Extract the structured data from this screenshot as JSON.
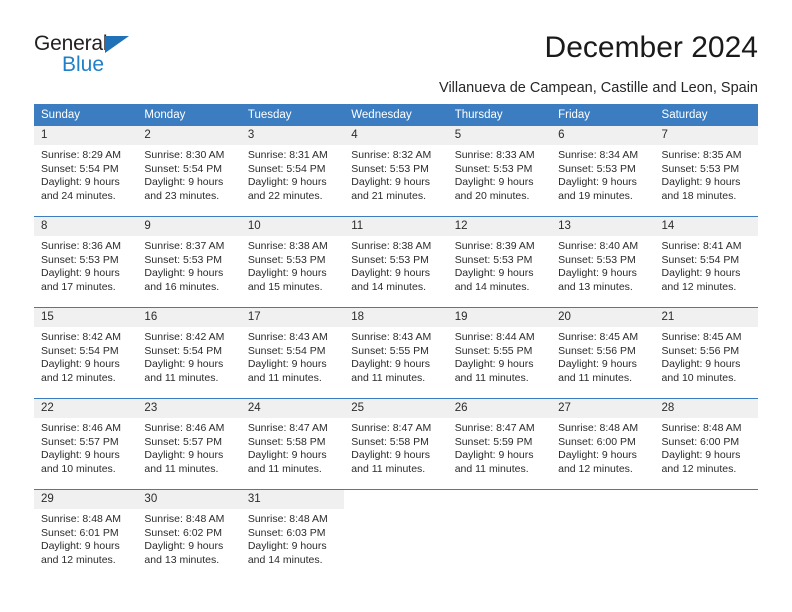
{
  "brand": {
    "name_dark": "General",
    "name_blue": "Blue",
    "accent_color": "#1f80c9",
    "triangle_color": "#1f71b8"
  },
  "header": {
    "title": "December 2024",
    "location": "Villanueva de Campean, Castille and Leon, Spain"
  },
  "calendar": {
    "header_bg": "#3b7dc0",
    "daynum_bg": "#f0f0f0",
    "weekday_headers": [
      "Sunday",
      "Monday",
      "Tuesday",
      "Wednesday",
      "Thursday",
      "Friday",
      "Saturday"
    ],
    "weeks": [
      [
        {
          "day": "1",
          "sunrise": "Sunrise: 8:29 AM",
          "sunset": "Sunset: 5:54 PM",
          "daylight1": "Daylight: 9 hours",
          "daylight2": "and 24 minutes."
        },
        {
          "day": "2",
          "sunrise": "Sunrise: 8:30 AM",
          "sunset": "Sunset: 5:54 PM",
          "daylight1": "Daylight: 9 hours",
          "daylight2": "and 23 minutes."
        },
        {
          "day": "3",
          "sunrise": "Sunrise: 8:31 AM",
          "sunset": "Sunset: 5:54 PM",
          "daylight1": "Daylight: 9 hours",
          "daylight2": "and 22 minutes."
        },
        {
          "day": "4",
          "sunrise": "Sunrise: 8:32 AM",
          "sunset": "Sunset: 5:53 PM",
          "daylight1": "Daylight: 9 hours",
          "daylight2": "and 21 minutes."
        },
        {
          "day": "5",
          "sunrise": "Sunrise: 8:33 AM",
          "sunset": "Sunset: 5:53 PM",
          "daylight1": "Daylight: 9 hours",
          "daylight2": "and 20 minutes."
        },
        {
          "day": "6",
          "sunrise": "Sunrise: 8:34 AM",
          "sunset": "Sunset: 5:53 PM",
          "daylight1": "Daylight: 9 hours",
          "daylight2": "and 19 minutes."
        },
        {
          "day": "7",
          "sunrise": "Sunrise: 8:35 AM",
          "sunset": "Sunset: 5:53 PM",
          "daylight1": "Daylight: 9 hours",
          "daylight2": "and 18 minutes."
        }
      ],
      [
        {
          "day": "8",
          "sunrise": "Sunrise: 8:36 AM",
          "sunset": "Sunset: 5:53 PM",
          "daylight1": "Daylight: 9 hours",
          "daylight2": "and 17 minutes."
        },
        {
          "day": "9",
          "sunrise": "Sunrise: 8:37 AM",
          "sunset": "Sunset: 5:53 PM",
          "daylight1": "Daylight: 9 hours",
          "daylight2": "and 16 minutes."
        },
        {
          "day": "10",
          "sunrise": "Sunrise: 8:38 AM",
          "sunset": "Sunset: 5:53 PM",
          "daylight1": "Daylight: 9 hours",
          "daylight2": "and 15 minutes."
        },
        {
          "day": "11",
          "sunrise": "Sunrise: 8:38 AM",
          "sunset": "Sunset: 5:53 PM",
          "daylight1": "Daylight: 9 hours",
          "daylight2": "and 14 minutes."
        },
        {
          "day": "12",
          "sunrise": "Sunrise: 8:39 AM",
          "sunset": "Sunset: 5:53 PM",
          "daylight1": "Daylight: 9 hours",
          "daylight2": "and 14 minutes."
        },
        {
          "day": "13",
          "sunrise": "Sunrise: 8:40 AM",
          "sunset": "Sunset: 5:53 PM",
          "daylight1": "Daylight: 9 hours",
          "daylight2": "and 13 minutes."
        },
        {
          "day": "14",
          "sunrise": "Sunrise: 8:41 AM",
          "sunset": "Sunset: 5:54 PM",
          "daylight1": "Daylight: 9 hours",
          "daylight2": "and 12 minutes."
        }
      ],
      [
        {
          "day": "15",
          "sunrise": "Sunrise: 8:42 AM",
          "sunset": "Sunset: 5:54 PM",
          "daylight1": "Daylight: 9 hours",
          "daylight2": "and 12 minutes."
        },
        {
          "day": "16",
          "sunrise": "Sunrise: 8:42 AM",
          "sunset": "Sunset: 5:54 PM",
          "daylight1": "Daylight: 9 hours",
          "daylight2": "and 11 minutes."
        },
        {
          "day": "17",
          "sunrise": "Sunrise: 8:43 AM",
          "sunset": "Sunset: 5:54 PM",
          "daylight1": "Daylight: 9 hours",
          "daylight2": "and 11 minutes."
        },
        {
          "day": "18",
          "sunrise": "Sunrise: 8:43 AM",
          "sunset": "Sunset: 5:55 PM",
          "daylight1": "Daylight: 9 hours",
          "daylight2": "and 11 minutes."
        },
        {
          "day": "19",
          "sunrise": "Sunrise: 8:44 AM",
          "sunset": "Sunset: 5:55 PM",
          "daylight1": "Daylight: 9 hours",
          "daylight2": "and 11 minutes."
        },
        {
          "day": "20",
          "sunrise": "Sunrise: 8:45 AM",
          "sunset": "Sunset: 5:56 PM",
          "daylight1": "Daylight: 9 hours",
          "daylight2": "and 11 minutes."
        },
        {
          "day": "21",
          "sunrise": "Sunrise: 8:45 AM",
          "sunset": "Sunset: 5:56 PM",
          "daylight1": "Daylight: 9 hours",
          "daylight2": "and 10 minutes."
        }
      ],
      [
        {
          "day": "22",
          "sunrise": "Sunrise: 8:46 AM",
          "sunset": "Sunset: 5:57 PM",
          "daylight1": "Daylight: 9 hours",
          "daylight2": "and 10 minutes."
        },
        {
          "day": "23",
          "sunrise": "Sunrise: 8:46 AM",
          "sunset": "Sunset: 5:57 PM",
          "daylight1": "Daylight: 9 hours",
          "daylight2": "and 11 minutes."
        },
        {
          "day": "24",
          "sunrise": "Sunrise: 8:47 AM",
          "sunset": "Sunset: 5:58 PM",
          "daylight1": "Daylight: 9 hours",
          "daylight2": "and 11 minutes."
        },
        {
          "day": "25",
          "sunrise": "Sunrise: 8:47 AM",
          "sunset": "Sunset: 5:58 PM",
          "daylight1": "Daylight: 9 hours",
          "daylight2": "and 11 minutes."
        },
        {
          "day": "26",
          "sunrise": "Sunrise: 8:47 AM",
          "sunset": "Sunset: 5:59 PM",
          "daylight1": "Daylight: 9 hours",
          "daylight2": "and 11 minutes."
        },
        {
          "day": "27",
          "sunrise": "Sunrise: 8:48 AM",
          "sunset": "Sunset: 6:00 PM",
          "daylight1": "Daylight: 9 hours",
          "daylight2": "and 12 minutes."
        },
        {
          "day": "28",
          "sunrise": "Sunrise: 8:48 AM",
          "sunset": "Sunset: 6:00 PM",
          "daylight1": "Daylight: 9 hours",
          "daylight2": "and 12 minutes."
        }
      ],
      [
        {
          "day": "29",
          "sunrise": "Sunrise: 8:48 AM",
          "sunset": "Sunset: 6:01 PM",
          "daylight1": "Daylight: 9 hours",
          "daylight2": "and 12 minutes."
        },
        {
          "day": "30",
          "sunrise": "Sunrise: 8:48 AM",
          "sunset": "Sunset: 6:02 PM",
          "daylight1": "Daylight: 9 hours",
          "daylight2": "and 13 minutes."
        },
        {
          "day": "31",
          "sunrise": "Sunrise: 8:48 AM",
          "sunset": "Sunset: 6:03 PM",
          "daylight1": "Daylight: 9 hours",
          "daylight2": "and 14 minutes."
        },
        {
          "day": "",
          "sunrise": "",
          "sunset": "",
          "daylight1": "",
          "daylight2": ""
        },
        {
          "day": "",
          "sunrise": "",
          "sunset": "",
          "daylight1": "",
          "daylight2": ""
        },
        {
          "day": "",
          "sunrise": "",
          "sunset": "",
          "daylight1": "",
          "daylight2": ""
        },
        {
          "day": "",
          "sunrise": "",
          "sunset": "",
          "daylight1": "",
          "daylight2": ""
        }
      ]
    ]
  }
}
